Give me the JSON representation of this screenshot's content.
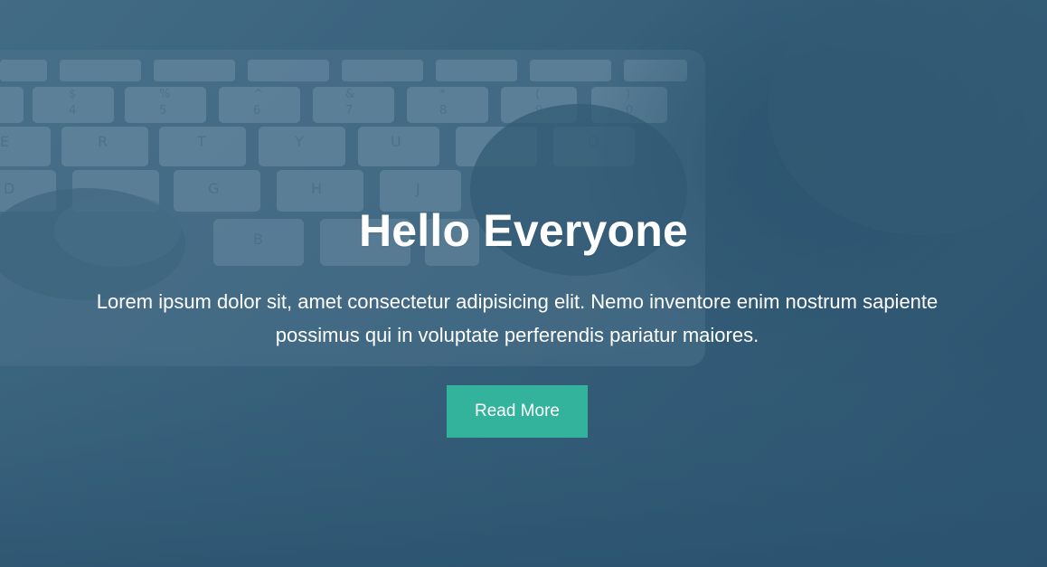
{
  "hero": {
    "title": "Hello Everyone",
    "subtitle": "Lorem ipsum dolor sit, amet consectetur adipisicing elit. Nemo inventore enim nostrum sapiente possimus qui in voluptate perferendis pariatur maiores.",
    "button_label": "Read More",
    "background_image": "keyboard-typing-photo"
  },
  "colors": {
    "overlay": "#3f6680",
    "button": "#33b39b",
    "text": "#ffffff"
  }
}
